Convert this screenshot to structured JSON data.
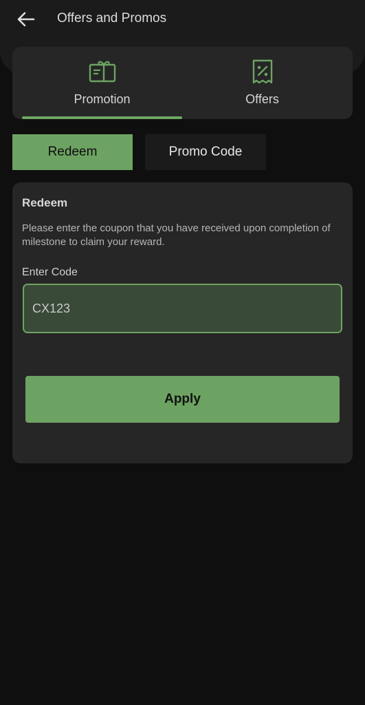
{
  "header": {
    "title": "Offers and Promos",
    "back_icon": "arrow-left-icon"
  },
  "tabs": [
    {
      "label": "Promotion",
      "icon": "gift-voucher-icon",
      "active": true
    },
    {
      "label": "Offers",
      "icon": "percent-receipt-icon",
      "active": false
    }
  ],
  "segments": {
    "redeem_label": "Redeem",
    "promo_label": "Promo Code",
    "active": "Redeem"
  },
  "redeem_card": {
    "title": "Redeem",
    "description": "Please enter the coupon that you have received upon completion of milestone to claim your reward.",
    "field_label": "Enter Code",
    "code_value": "CX123",
    "apply_label": "Apply"
  },
  "colors": {
    "accent": "#6da362",
    "background": "#0f0f0f",
    "card": "#262626"
  }
}
